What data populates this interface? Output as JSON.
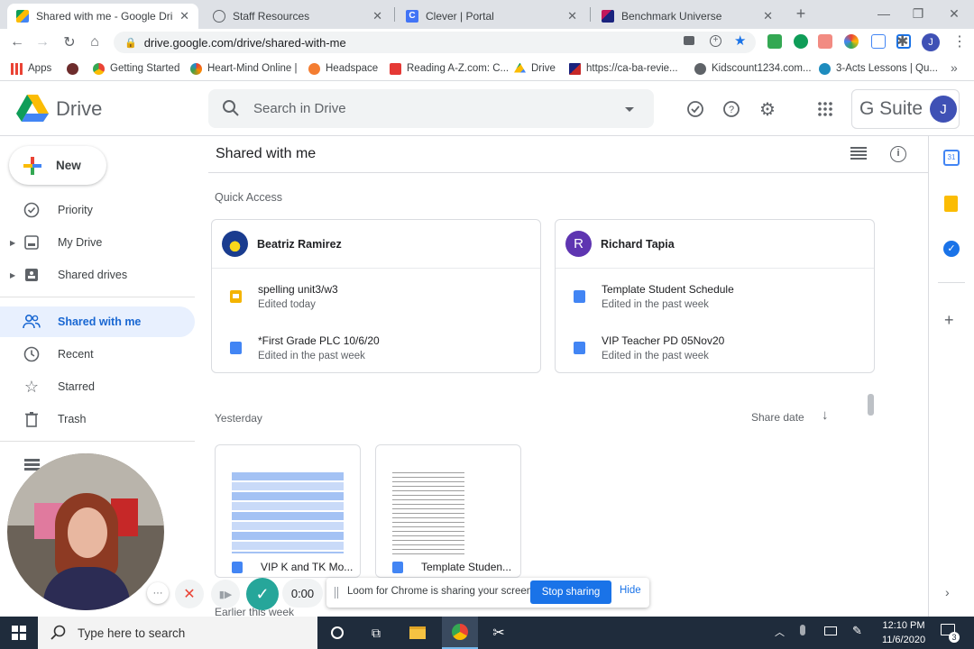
{
  "browser": {
    "tabs": [
      {
        "title": "Shared with me - Google Dri",
        "active": true
      },
      {
        "title": "Staff Resources"
      },
      {
        "title": "Clever | Portal"
      },
      {
        "title": "Benchmark Universe"
      }
    ],
    "new_tab": "+",
    "url": "drive.google.com/drive/shared-with-me",
    "profile_initial": "J",
    "bookmarks": [
      "Apps",
      "Getting Started",
      "Heart-Mind Online |",
      "Headspace",
      "Reading A-Z.com: C...",
      "Drive",
      "https://ca-ba-revie...",
      "Kidscount1234.com...",
      "3-Acts Lessons | Qu..."
    ]
  },
  "drive": {
    "app_name": "Drive",
    "search_placeholder": "Search in Drive",
    "gsuite_label": "G Suite",
    "account_initial": "J",
    "new_button": "New",
    "nav": [
      {
        "label": "Priority"
      },
      {
        "label": "My Drive"
      },
      {
        "label": "Shared drives"
      },
      {
        "label": "Shared with me",
        "selected": true
      },
      {
        "label": "Recent"
      },
      {
        "label": "Starred"
      },
      {
        "label": "Trash"
      }
    ],
    "page_title": "Shared with me",
    "quick_access_label": "Quick Access",
    "quick_access": [
      {
        "owner": "Beatriz Ramirez",
        "files": [
          {
            "name": "spelling unit3/w3",
            "sub": "Edited today",
            "type": "slides"
          },
          {
            "name": "*First Grade PLC 10/6/20",
            "sub": "Edited in the past week",
            "type": "docs"
          }
        ]
      },
      {
        "owner": "Richard Tapia",
        "owner_initial": "R",
        "files": [
          {
            "name": "Template Student Schedule",
            "sub": "Edited in the past week",
            "type": "docs"
          },
          {
            "name": "VIP Teacher PD 05Nov20",
            "sub": "Edited in the past week",
            "type": "docs"
          }
        ]
      }
    ],
    "section_yesterday": "Yesterday",
    "sort_label": "Share date",
    "grid_files": [
      {
        "name": "VIP K and TK Mo..."
      },
      {
        "name": "Template Studen..."
      }
    ],
    "section_earlier": "Earlier this week"
  },
  "loom": {
    "timer": "0:00",
    "message": "Loom for Chrome is sharing your screen.",
    "stop_label": "Stop sharing",
    "hide_label": "Hide"
  },
  "taskbar": {
    "search_placeholder": "Type here to search",
    "time": "12:10 PM",
    "date": "11/6/2020",
    "notification_count": "3"
  },
  "colors": {
    "selected_nav_bg": "#e8f0fe",
    "selected_nav_text": "#1967d2",
    "loom_button": "#1a73e8",
    "purple_avatar": "#5e35b1"
  }
}
